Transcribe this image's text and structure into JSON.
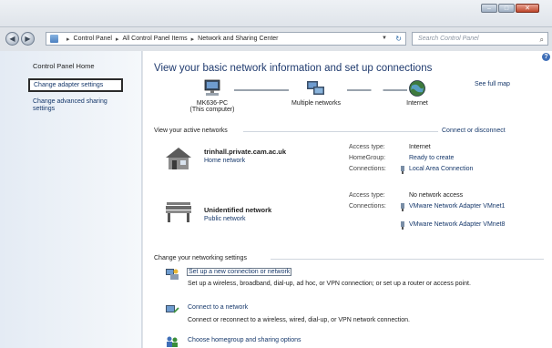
{
  "window": {
    "controls": [
      "–",
      "□",
      "✕"
    ]
  },
  "address_bar": {
    "crumbs": [
      "Control Panel",
      "All Control Panel Items",
      "Network and Sharing Center"
    ],
    "search_placeholder": "Search Control Panel"
  },
  "left_pane": {
    "home": "Control Panel Home",
    "change_adapter": "Change adapter settings",
    "change_sharing": "Change advanced sharing settings"
  },
  "main": {
    "heading": "View your basic network information and set up connections",
    "see_full_map": "See full map",
    "map": {
      "computer_name": "MK636-PC",
      "computer_sub": "(This computer)",
      "middle": "Multiple networks",
      "internet": "Internet"
    },
    "active_title": "View your active networks",
    "connect_disconnect": "Connect or disconnect",
    "networks": [
      {
        "name": "trinhall.private.cam.ac.uk",
        "type": "Home network",
        "access_key": "Access type:",
        "access_val": "Internet",
        "homegroup_key": "HomeGroup:",
        "homegroup_val": "Ready to create",
        "connections_key": "Connections:",
        "connection": "Local Area Connection"
      },
      {
        "name": "Unidentified network",
        "type": "Public network",
        "access_key": "Access type:",
        "access_val": "No network access",
        "connections_key": "Connections:",
        "connection1": "VMware Network Adapter VMnet1",
        "connection2": "VMware Network Adapter VMnet8"
      }
    ],
    "settings_title": "Change your networking settings",
    "tasks": [
      {
        "link": "Set up a new connection or network",
        "desc": "Set up a wireless, broadband, dial-up, ad hoc, or VPN connection; or set up a router or access point."
      },
      {
        "link": "Connect to a network",
        "desc": "Connect or reconnect to a wireless, wired, dial-up, or VPN network connection."
      },
      {
        "link": "Choose homegroup and sharing options"
      }
    ]
  }
}
